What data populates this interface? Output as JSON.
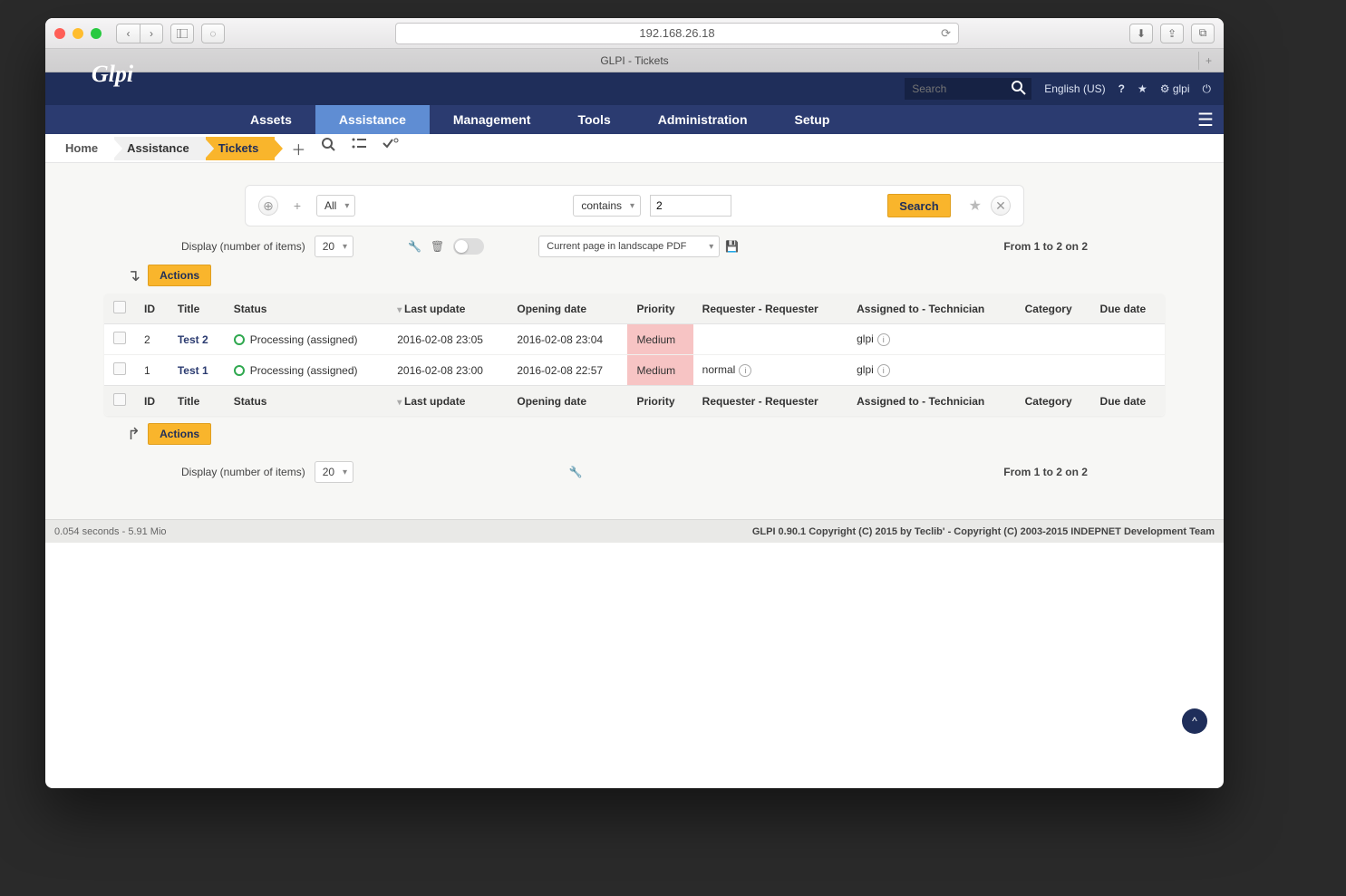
{
  "browser": {
    "url": "192.168.26.18",
    "tab_title": "GLPI - Tickets"
  },
  "topbar": {
    "search_placeholder": "Search",
    "lang": "English (US)",
    "user": "glpi"
  },
  "nav": [
    "Assets",
    "Assistance",
    "Management",
    "Tools",
    "Administration",
    "Setup"
  ],
  "nav_active": "Assistance",
  "crumbs": {
    "home": "Home",
    "mid": "Assistance",
    "active": "Tickets"
  },
  "filter": {
    "field": "All",
    "op": "contains",
    "value": "2",
    "search": "Search"
  },
  "display": {
    "label": "Display (number of items)",
    "count": "20",
    "pdf": "Current page in landscape PDF",
    "range": "From 1 to 2 on 2"
  },
  "actions_label": "Actions",
  "columns": [
    "ID",
    "Title",
    "Status",
    "Last update",
    "Opening date",
    "Priority",
    "Requester - Requester",
    "Assigned to - Technician",
    "Category",
    "Due date"
  ],
  "rows": [
    {
      "id": "2",
      "title": "Test 2",
      "status": "Processing (assigned)",
      "last": "2016-02-08 23:05",
      "open": "2016-02-08 23:04",
      "prio": "Medium",
      "req": "",
      "assignee": "glpi"
    },
    {
      "id": "1",
      "title": "Test 1",
      "status": "Processing (assigned)",
      "last": "2016-02-08 23:00",
      "open": "2016-02-08 22:57",
      "prio": "Medium",
      "req": "normal",
      "assignee": "glpi"
    }
  ],
  "footer": {
    "left": "0.054 seconds - 5.91 Mio",
    "right": "GLPI 0.90.1 Copyright (C) 2015 by Teclib' - Copyright (C) 2003-2015 INDEPNET Development Team"
  },
  "scroll_top": "^"
}
